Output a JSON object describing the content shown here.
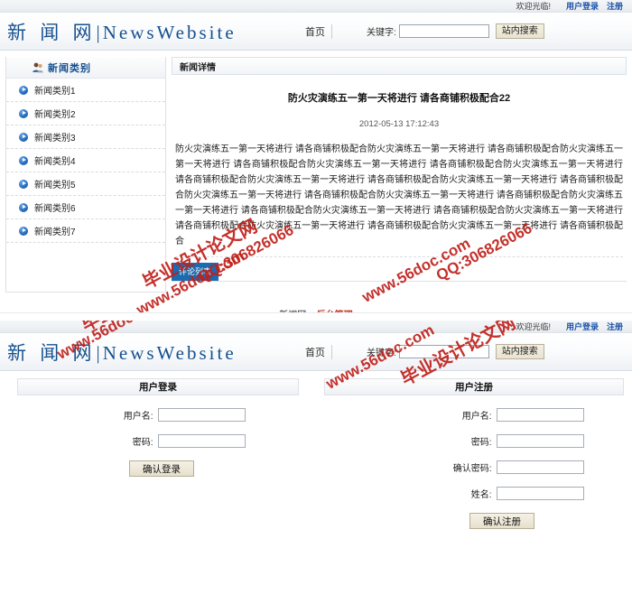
{
  "site": {
    "logo_cn": "新 闻 网",
    "logo_sep": "|",
    "logo_en": "NewsWebsite"
  },
  "topbar": {
    "welcome": "欢迎光临!",
    "login_link": "用户登录",
    "register_link": "注册"
  },
  "header": {
    "home_link": "首页",
    "keyword_label": "关键字:",
    "keyword_value": "",
    "search_button": "站内搜索"
  },
  "sidebar": {
    "title": "新闻类别",
    "icon": "users-icon",
    "items": [
      {
        "label": "新闻类别1",
        "icon": "arrow-circle-icon"
      },
      {
        "label": "新闻类别2",
        "icon": "arrow-circle-icon"
      },
      {
        "label": "新闻类别3",
        "icon": "arrow-circle-icon"
      },
      {
        "label": "新闻类别4",
        "icon": "arrow-circle-icon"
      },
      {
        "label": "新闻类别5",
        "icon": "arrow-circle-icon"
      },
      {
        "label": "新闻类别6",
        "icon": "arrow-circle-icon"
      },
      {
        "label": "新闻类别7",
        "icon": "arrow-circle-icon"
      }
    ]
  },
  "detail": {
    "panel_heading": "新闻详情",
    "title": "防火灾演练五一第一天将进行  请各商铺积极配合22",
    "date": "2012-05-13 17:12:43",
    "body": "防火灾演练五一第一天将进行  请各商铺积极配合防火灾演练五一第一天将进行  请各商铺积极配合防火灾演练五一第一天将进行  请各商铺积极配合防火灾演练五一第一天将进行  请各商铺积极配合防火灾演练五一第一天将进行  请各商铺积极配合防火灾演练五一第一天将进行  请各商铺积极配合防火灾演练五一第一天将进行  请各商铺积极配合防火灾演练五一第一天将进行  请各商铺积极配合防火灾演练五一第一天将进行  请各商铺积极配合防火灾演练五一第一天将进行  请各商铺积极配合防火灾演练五一第一天将进行  请各商铺积极配合防火灾演练五一第一天将进行  请各商铺积极配合防火灾演练五一第一天将进行  请各商铺积极配合防火灾演练五一第一天将进行  请各商铺积极配合",
    "comment_tab": "评论列表"
  },
  "footer": {
    "site_name": "新闻网.",
    "admin_link": "后台管理"
  },
  "login_form": {
    "heading": "用户登录",
    "fields": [
      {
        "label": "用户名:",
        "value": "",
        "type": "text"
      },
      {
        "label": "密码:",
        "value": "",
        "type": "password"
      }
    ],
    "submit": "确认登录"
  },
  "register_form": {
    "heading": "用户注册",
    "fields": [
      {
        "label": "用户名:",
        "value": "",
        "type": "text"
      },
      {
        "label": "密码:",
        "value": "",
        "type": "password"
      },
      {
        "label": "确认密码:",
        "value": "",
        "type": "password"
      },
      {
        "label": "姓名:",
        "value": "",
        "type": "text"
      }
    ],
    "submit": "确认注册"
  },
  "watermarks": {
    "color": "#c0201b",
    "texts": {
      "brand": "毕业设计论文网",
      "site": "www.56doc.com",
      "qq": "QQ:306826066"
    }
  }
}
